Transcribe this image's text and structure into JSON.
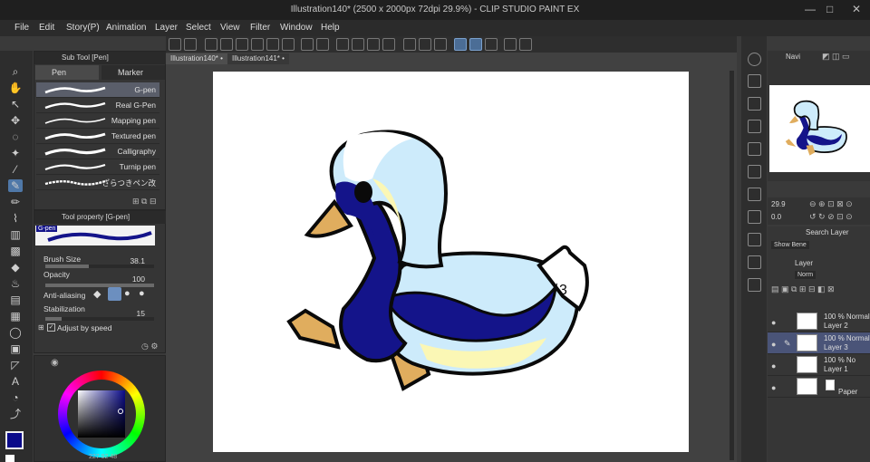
{
  "window": {
    "title": "Illustration140* (2500 x 2000px 72dpi 29.9%) - CLIP STUDIO PAINT EX",
    "minimize": "—",
    "maximize": "□",
    "close": "✕"
  },
  "menu": [
    "File",
    "Edit",
    "Story(P)",
    "Animation",
    "Layer",
    "Select",
    "View",
    "Filter",
    "Window",
    "Help"
  ],
  "subtool": {
    "header": "Sub Tool [Pen]",
    "tabs": [
      "Pen",
      "Marker"
    ],
    "brushes": [
      "G-pen",
      "Real G-Pen",
      "Mapping pen",
      "Textured pen",
      "Calligraphy",
      "Turnip pen",
      "ざらつきペン改"
    ],
    "selected_index": 0
  },
  "toolprop": {
    "header": "Tool property [G-pen]",
    "brush_name": "G-pen",
    "brush_size_label": "Brush Size",
    "brush_size_value": "38.1",
    "opacity_label": "Opacity",
    "opacity_value": "100",
    "antialias_label": "Anti-aliasing",
    "stabilization_label": "Stabilization",
    "stabilization_value": "15",
    "adjust_label": "Adjust by speed"
  },
  "color": {
    "main": "#0a0a8a",
    "sub": "#0a0a8a",
    "values": "227  92  48"
  },
  "doc_tabs": [
    "Illustration140*",
    "Illustration141*"
  ],
  "navigator": {
    "label": "Navi"
  },
  "zoom": {
    "value": "29.9",
    "rotation": "0.0"
  },
  "layers": {
    "search_label": "Search Layer",
    "tab_label": "Layer",
    "blend_mode": "Norm",
    "show_label": "Show Bene",
    "items": [
      {
        "line1": "100 % Normal",
        "line2": "Layer 2",
        "selected": false
      },
      {
        "line1": "100 % Normal",
        "line2": "Layer 3",
        "selected": true
      },
      {
        "line1": "100 % No",
        "line2": "Layer 1",
        "selected": false
      },
      {
        "line1": "",
        "line2": "Paper",
        "selected": false
      }
    ]
  },
  "colors": {
    "ink": "#0a0a0a",
    "navy": "#14148a",
    "lightblue": "#cdebfb",
    "yellow": "#fbf7b5",
    "beak": "#e0ad5e"
  }
}
